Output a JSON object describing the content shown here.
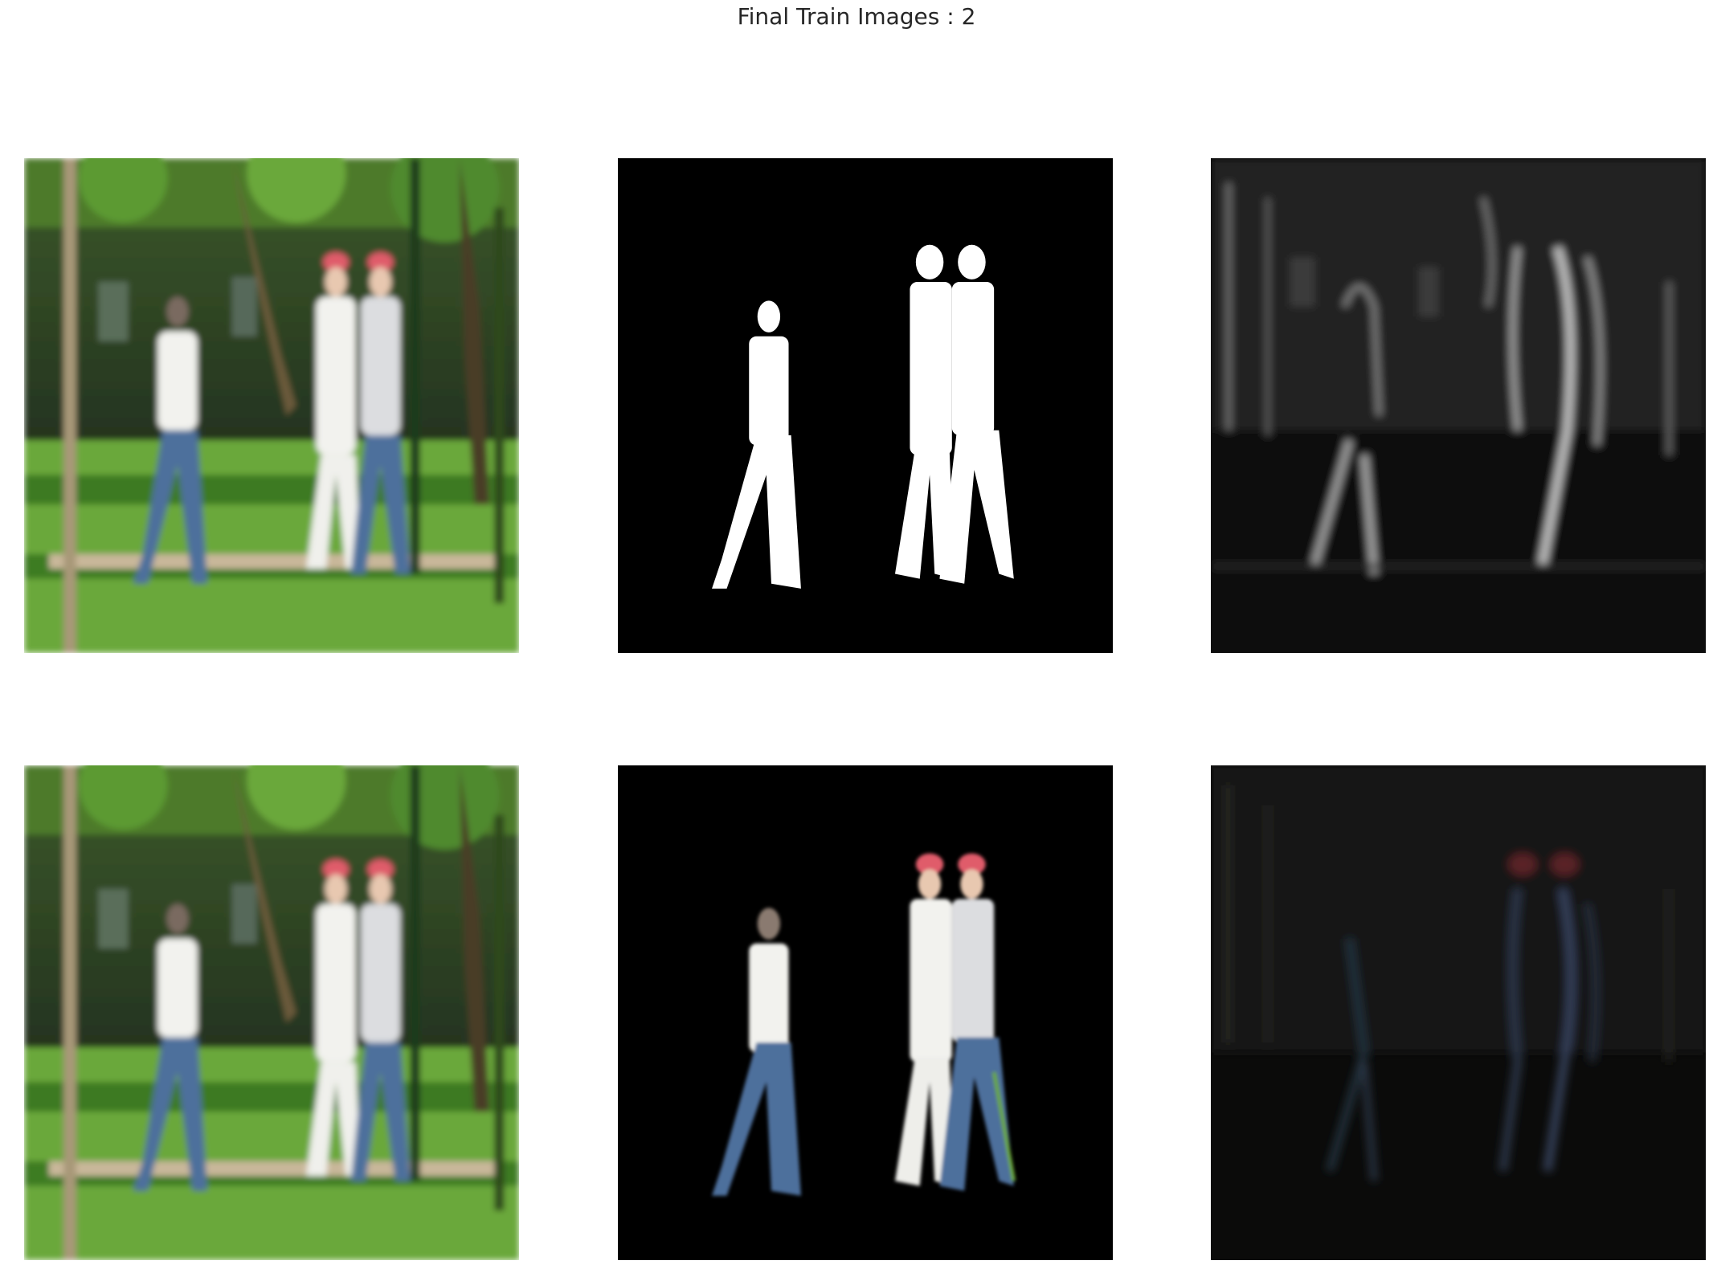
{
  "figure": {
    "title": "Final Train Images : 2"
  },
  "colors": {
    "grass": "#6aa83a",
    "foliage": "#2e5a1c",
    "building": "#2b3a26",
    "path": "#c9b79a",
    "mask_bg": "#000000",
    "mask_fg": "#ffffff",
    "shirt_white": "#f2f2ee",
    "jeans": "#4d6f9c",
    "cap": "#e05b6a"
  },
  "panels": [
    {
      "row": 1,
      "col": 1,
      "content": "park-scene"
    },
    {
      "row": 1,
      "col": 2,
      "content": "binary-mask"
    },
    {
      "row": 1,
      "col": 3,
      "content": "grayscale-prediction"
    },
    {
      "row": 2,
      "col": 1,
      "content": "park-scene"
    },
    {
      "row": 2,
      "col": 2,
      "content": "masked-people"
    },
    {
      "row": 2,
      "col": 3,
      "content": "dark-color-prediction"
    }
  ]
}
